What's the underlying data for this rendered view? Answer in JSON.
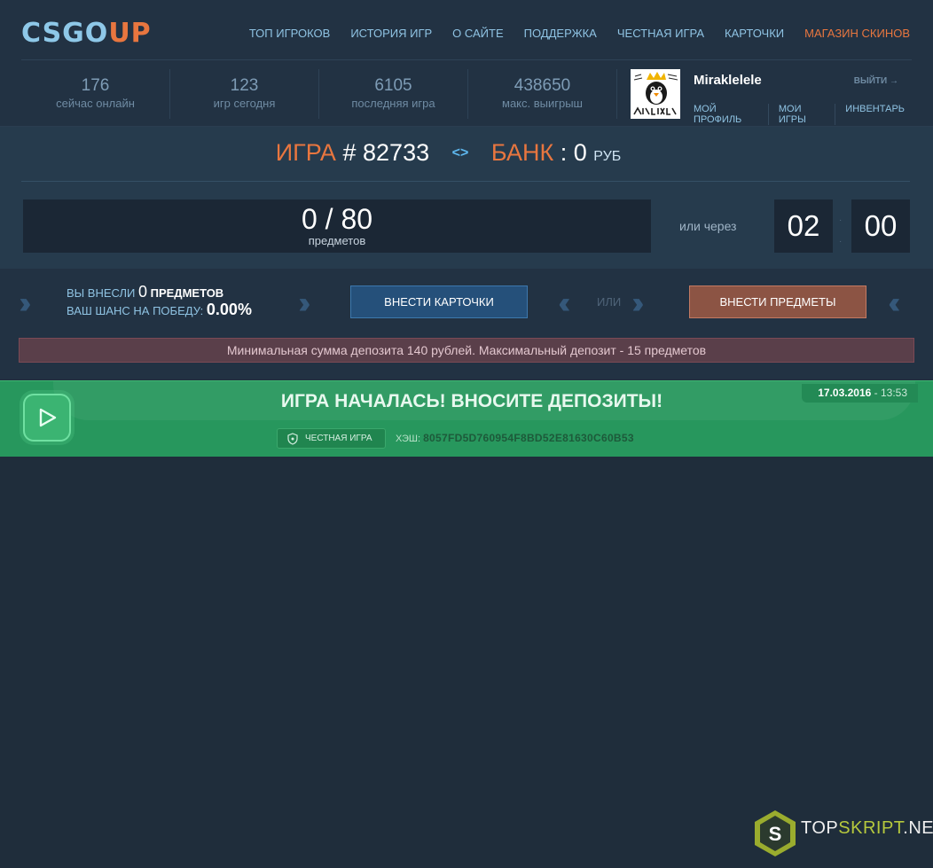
{
  "brand": {
    "logo_a": "CSGO",
    "logo_b": "UP"
  },
  "nav": [
    "ТОП ИГРОКОВ",
    "ИСТОРИЯ ИГР",
    "О САЙТЕ",
    "ПОДДЕРЖКА",
    "ЧЕСТНАЯ ИГРА",
    "КАРТОЧКИ",
    "МАГАЗИН СКИНОВ"
  ],
  "stats": [
    {
      "value": "176",
      "label": "сейчас онлайн"
    },
    {
      "value": "123",
      "label": "игр сегодня"
    },
    {
      "value": "6105",
      "label": "последняя игра"
    },
    {
      "value": "438650",
      "label": "макс. выигрыш"
    }
  ],
  "user": {
    "name": "Miraklelele",
    "logout": "ВЫЙТИ →",
    "links": [
      "МОЙ ПРОФИЛЬ",
      "МОИ ИГРЫ",
      "ИНВЕНТАРЬ"
    ]
  },
  "game": {
    "game_label": "ИГРА",
    "hash_sign": "#",
    "game_number": "82733",
    "bank_label": "БАНК",
    "bank_sep": ":",
    "bank_value": "0",
    "bank_currency": "РУБ",
    "items_count": "0 / 80",
    "items_label": "предметов",
    "or_through": "или через",
    "timer_min": "02",
    "timer_sec": "00"
  },
  "deposit": {
    "you_prefix": "ВЫ ВНЕСЛИ",
    "you_count": "0",
    "you_suffix": "ПРЕДМЕТОВ",
    "chance_label": "ВАШ ШАНС НА ПОБЕДУ:",
    "chance_value": "0.00%",
    "btn_cards": "ВНЕСТИ КАРТОЧКИ",
    "or": "ИЛИ",
    "btn_items": "ВНЕСТИ ПРЕДМЕТЫ",
    "notice": "Минимальная сумма депозита 140 рублей. Максимальный депозит - 15 предметов"
  },
  "banner": {
    "title": "ИГРА НАЧАЛАСЬ! ВНОСИТЕ ДЕПОЗИТЫ!",
    "date": "17.03.2016",
    "time": "- 13:53",
    "fair_label": "ЧЕСТНАЯ ИГРА",
    "hash_label": "ХЭШ:",
    "hash_value": "8057FD5D760954F8BD52E81630C60B53"
  },
  "watermark": {
    "a": "TOP",
    "b": "SKRIPT",
    "c": ".NET",
    "badge": "S"
  },
  "colors": {
    "bg": "#1f2d3b",
    "accent_orange": "#e8763f",
    "accent_blue": "#8fc3e3",
    "green": "#27975d"
  }
}
